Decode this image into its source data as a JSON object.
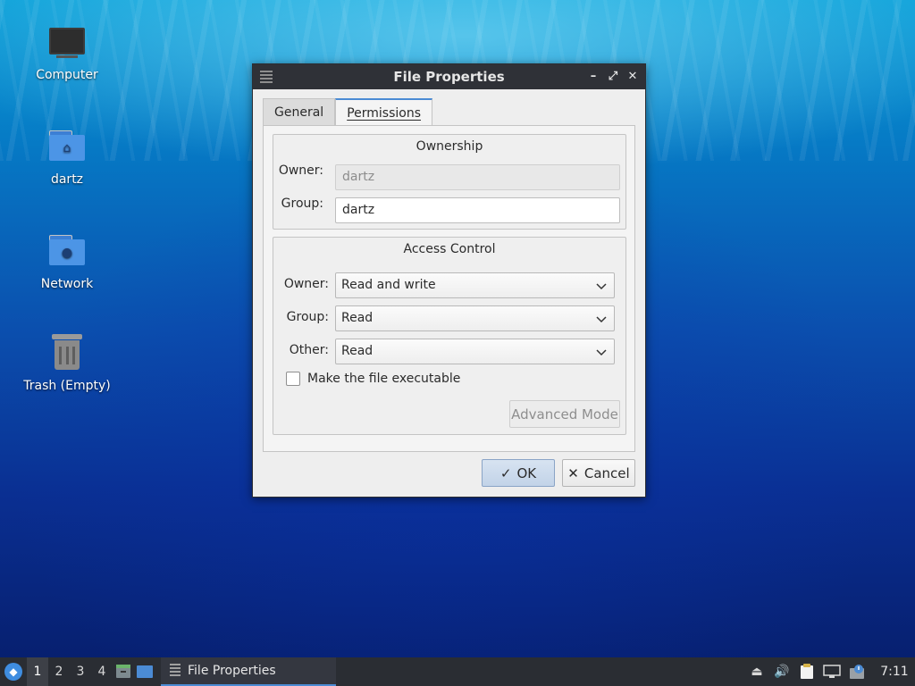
{
  "desktop": {
    "icons": [
      {
        "label": "Computer",
        "icon": "computer-icon"
      },
      {
        "label": "dartz",
        "icon": "home-folder-icon"
      },
      {
        "label": "Network",
        "icon": "network-folder-icon"
      },
      {
        "label": "Trash (Empty)",
        "icon": "trash-icon"
      }
    ]
  },
  "dialog": {
    "title": "File Properties",
    "tabs": [
      {
        "label": "General",
        "active": false
      },
      {
        "label": "Permissions",
        "active": true
      }
    ],
    "ownership": {
      "title": "Ownership",
      "owner_label": "Owner:",
      "owner_value": "dartz",
      "group_label": "Group:",
      "group_value": "dartz"
    },
    "access_control": {
      "title": "Access Control",
      "owner_label": "Owner:",
      "owner_value": "Read and write",
      "group_label": "Group:",
      "group_value": "Read",
      "other_label": "Other:",
      "other_value": "Read",
      "executable_label": "Make the file executable",
      "executable_checked": false,
      "advanced_label": "Advanced Mode"
    },
    "buttons": {
      "ok_label": "OK",
      "cancel_label": "Cancel"
    }
  },
  "taskbar": {
    "workspaces": [
      "1",
      "2",
      "3",
      "4"
    ],
    "active_workspace": "1",
    "task_label": "File Properties",
    "clock": "7:11"
  },
  "colors": {
    "accent": "#4b8bd4",
    "titlebar": "#2f3137",
    "taskbar": "#2a2d33"
  }
}
